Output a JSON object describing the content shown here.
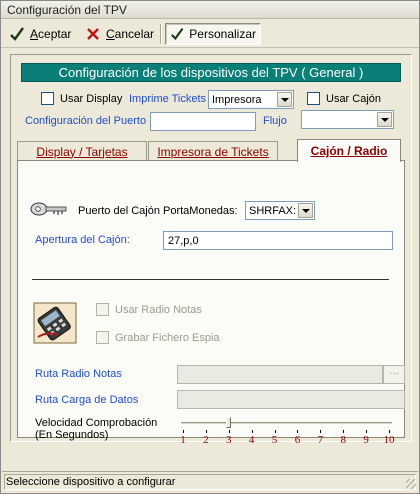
{
  "window": {
    "title": "Configuración del TPV"
  },
  "toolbar": {
    "accept": {
      "underlined": "A",
      "rest": "ceptar"
    },
    "cancel": {
      "underlined": "C",
      "rest": "ancelar"
    },
    "customize": {
      "label": "Personalizar",
      "pressed": true
    }
  },
  "header": {
    "title": "Configuración de los dispositivos del TPV ( General )"
  },
  "general": {
    "use_display_label": "Usar Display",
    "use_display_checked": false,
    "print_tickets_label": "Imprime Tickets",
    "printer_select_value": "Impresora",
    "use_drawer_label": "Usar Cajón",
    "use_drawer_checked": false,
    "port_config_label": "Configuración del Puerto",
    "port_config_value": "",
    "flow_label": "Flujo",
    "flow_select_value": ""
  },
  "tabs": [
    {
      "label": "Display / Tarjetas",
      "active": false
    },
    {
      "label": "Impresora de Tickets",
      "active": false
    },
    {
      "label": "Cajón / Radio",
      "active": true
    }
  ],
  "drawer": {
    "port_label": "Puerto del Cajón PortaMonedas:",
    "port_value": "SHRFAX:",
    "opening_label": "Apertura del Cajón:",
    "opening_value": "27,p,0"
  },
  "radio": {
    "use_radio_label": "Usar Radio Notas",
    "use_radio_checked": false,
    "spy_file_label": "Grabar Fichero Espia",
    "spy_file_checked": false,
    "route_notes_label": "Ruta Radio Notas",
    "route_notes_value": "",
    "browse_label": "...",
    "route_load_label": "Ruta Carga de Datos",
    "route_load_value": "",
    "speed_label_line1": "Velocidad Comprobación",
    "speed_label_line2": "(En Segundos)",
    "speed_value": 3,
    "speed_min": 1,
    "speed_max": 10,
    "speed_ticks": [
      "1",
      "2",
      "3",
      "4",
      "5",
      "6",
      "7",
      "8",
      "9",
      "10"
    ]
  },
  "status": {
    "text": "Seleccione dispositivo a configurar"
  },
  "icons": {
    "accept": "checkmark-icon",
    "cancel": "x-icon",
    "customize": "checkmark-icon",
    "drawer_port": "key-icon",
    "radio": "radio-handheld-icon"
  },
  "colors": {
    "header_bg": "#0a7f78",
    "label_blue": "#1f4fc8",
    "tab_text": "#8b0000",
    "tick_label": "#8b0000"
  }
}
